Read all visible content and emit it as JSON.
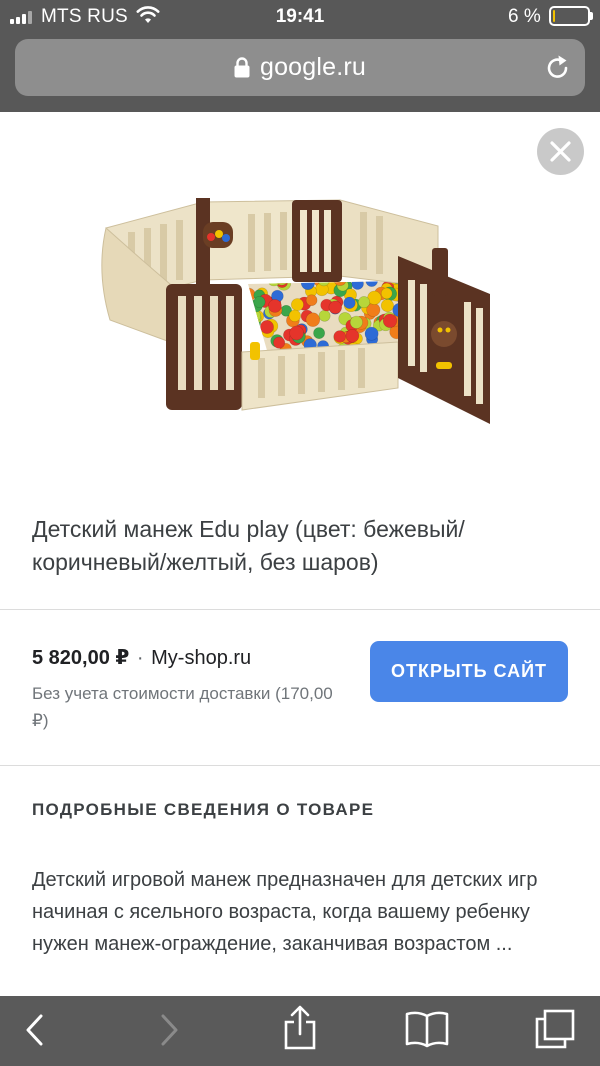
{
  "status_bar": {
    "carrier": "MTS RUS",
    "time": "19:41",
    "battery_percent": "6 %",
    "battery_level": 0.06,
    "signal_bars_filled": 3,
    "signal_bars_total": 4
  },
  "browser": {
    "url": "google.ru",
    "lock_icon": "lock-icon",
    "reload_icon": "reload-icon"
  },
  "product": {
    "close_icon": "close-icon",
    "image_alt": "playpen-with-balls",
    "title": "Детский манеж Edu play (цвет: бежевый/коричневый/желтый, без шаров)",
    "price": "5 820,00 ₽",
    "separator": "·",
    "shop": "My-shop.ru",
    "shipping_note": "Без учета стоимости доставки (170,00 ₽)",
    "open_site_button": "ОТКРЫТЬ САЙТ",
    "details_heading": "ПОДРОБНЫЕ СВЕДЕНИЯ О ТОВАРЕ",
    "description": "Детский игровой манеж предназначен для детских игр начиная с ясельного возраста, когда вашему ребенку нужен манеж-ограждение, заканчивая возрастом ..."
  },
  "toolbar": {
    "icons": [
      "back-icon",
      "forward-icon",
      "share-icon",
      "bookmarks-icon",
      "tabs-icon"
    ]
  },
  "colors": {
    "chrome_bg": "#585858",
    "url_bar_bg": "#8e8e8e",
    "button_blue": "#4a86e8",
    "battery_yellow": "#f2c200",
    "text_dark": "#3c4043",
    "text_muted": "#70757a"
  }
}
